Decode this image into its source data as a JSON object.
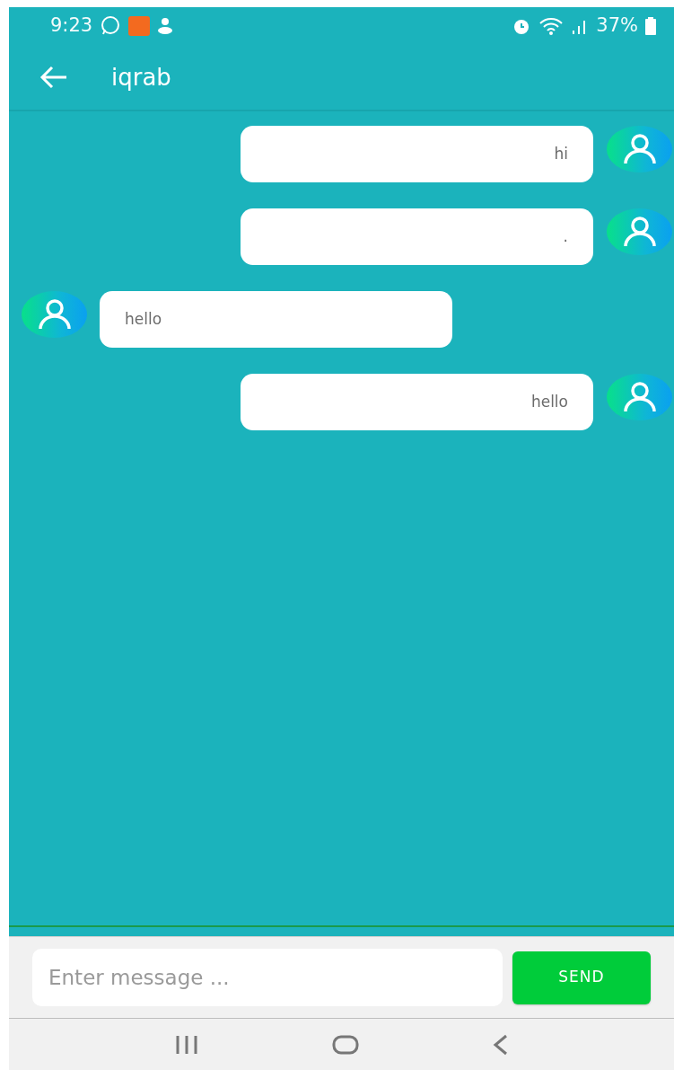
{
  "status_bar": {
    "time": "9:23",
    "battery": "37%"
  },
  "app_bar": {
    "title": "iqrab"
  },
  "messages": [
    {
      "kind": "sent",
      "text": "hi"
    },
    {
      "kind": "sent",
      "text": "."
    },
    {
      "kind": "received",
      "text": "hello"
    },
    {
      "kind": "sent",
      "text": "hello"
    }
  ],
  "composer": {
    "placeholder": "Enter message ...",
    "send_label": "SEND"
  }
}
